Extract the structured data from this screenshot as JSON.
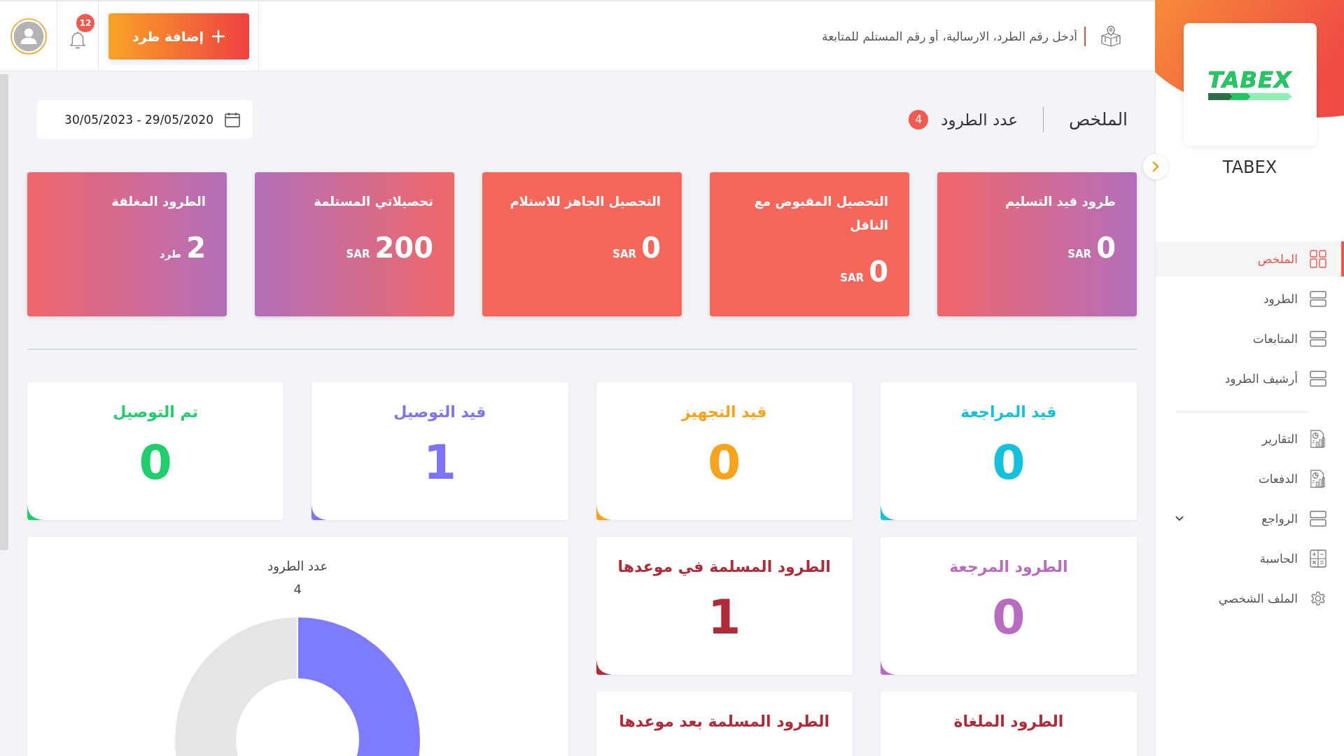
{
  "header": {
    "search": {
      "placeholder": "أدخل رقم الطرد، الارسالية، أو رقم المستلم للمتابعة"
    },
    "add_button": "إضافة طرد",
    "notifications_count": "12"
  },
  "sidebar": {
    "logo": {
      "wordmark": "TABEX"
    },
    "company_name": "TABEX",
    "menu_groups": [
      {
        "items": [
          {
            "label": "الملخص",
            "kind": "dashboard",
            "selected": true,
            "expandable": false
          },
          {
            "label": "الطرود",
            "kind": "list",
            "selected": false,
            "expandable": false
          },
          {
            "label": "المتابعات",
            "kind": "list",
            "selected": false,
            "expandable": false
          },
          {
            "label": "أرشيف الطرود",
            "kind": "list",
            "selected": false,
            "expandable": false
          }
        ]
      },
      {
        "items": [
          {
            "label": "التقارير",
            "kind": "report",
            "selected": false,
            "expandable": false
          },
          {
            "label": "الدفعات",
            "kind": "report",
            "selected": false,
            "expandable": false
          },
          {
            "label": "الرواجع",
            "kind": "list",
            "selected": false,
            "expandable": true
          },
          {
            "label": "الحاسبة",
            "kind": "calculator",
            "selected": false,
            "expandable": false
          },
          {
            "label": "الملف الشخصي",
            "kind": "settings",
            "selected": false,
            "expandable": false
          }
        ]
      }
    ]
  },
  "summary": {
    "title": "الملخص",
    "parcels_label": "عدد الطرود",
    "parcels_count": "4",
    "date_range": "30/05/2023 - 29/05/2020"
  },
  "summary_cards": [
    {
      "title": "طرود قيد التسليم",
      "value": "0",
      "unit": "SAR"
    },
    {
      "title": "التحصيل المقبوض مع الناقل",
      "value": "0",
      "unit": "SAR"
    },
    {
      "title": "التحصيل الجاهز للاستلام",
      "value": "0",
      "unit": "SAR"
    },
    {
      "title": "تحصيلاتي المستلمة",
      "value": "200",
      "unit": "SAR"
    },
    {
      "title": "الطرود المغلقة",
      "value": "2",
      "unit": "طرد"
    }
  ],
  "status_cards": [
    {
      "title": "قيد المراجعة",
      "value": "0",
      "color": "#13c1dc"
    },
    {
      "title": "قيد التجهيز",
      "value": "0",
      "color": "#f9a21c"
    },
    {
      "title": "قيد التوصيل",
      "value": "1",
      "color": "#7d73f7"
    },
    {
      "title": "تم التوصيل",
      "value": "0",
      "color": "#1fcf6b"
    },
    {
      "title": "الطرود المرجعة",
      "value": "0",
      "color": "#b96bc0"
    },
    {
      "title": "الطرود المسلمة في موعدها",
      "value": "1",
      "color": "#b02a37"
    },
    {
      "title": "الطرود الملغاة",
      "color": "#b02a37"
    },
    {
      "title": "الطرود المسلمة بعد موعدها",
      "color": "#b02a37"
    }
  ],
  "chart": {
    "title": "عدد الطرود",
    "total": "4"
  }
}
